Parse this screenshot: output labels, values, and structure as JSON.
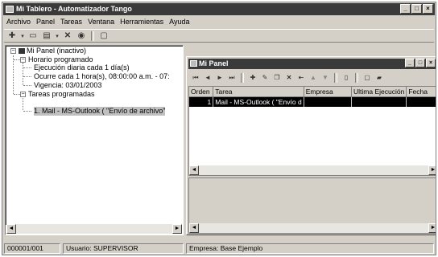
{
  "window": {
    "title": "Mi Tablero - Automatizador Tango",
    "buttons": [
      "_",
      "□",
      "×"
    ]
  },
  "menu": [
    "Archivo",
    "Panel",
    "Tareas",
    "Ventana",
    "Herramientas",
    "Ayuda"
  ],
  "toolbar": {
    "icons": [
      "new-item-icon",
      "dropdown-arrow-icon",
      "open-icon",
      "save-icon",
      "dropdown-arrow-icon",
      "delete-icon",
      "help-icon",
      "window-icon"
    ]
  },
  "tree": {
    "root": "Mi Panel (inactivo)",
    "schedule": "Horario programado",
    "schedule_items": [
      "Ejecución diaria cada 1 día(s)",
      "Ocurre cada 1 hora(s), 08:00:00 a.m. - 07:",
      "Vigencia: 03/01/2003"
    ],
    "tasks": "Tareas programadas",
    "task_items": [
      "1. Mail - MS-Outlook ( \"Envío de archivo\""
    ]
  },
  "panel": {
    "title": "Mi Panel",
    "buttons": [
      "_",
      "□",
      "×"
    ],
    "columns": [
      "Orden",
      "Tarea",
      "Empresa",
      "Ultima Ejecución",
      "Fecha"
    ],
    "rows": [
      {
        "orden": "1",
        "tarea": "Mail - MS-Outlook ( \"Envío d",
        "empresa": "",
        "ultima": "",
        "fecha": ""
      }
    ]
  },
  "status": {
    "record": "000001/001",
    "user": "Usuario: SUPERVISOR",
    "company": "Empresa: Base Ejemplo"
  }
}
